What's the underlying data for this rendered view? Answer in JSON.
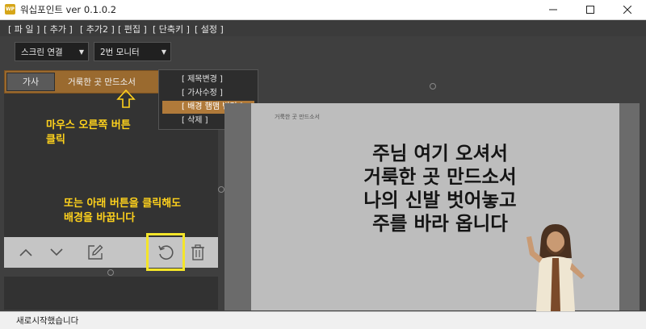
{
  "window": {
    "app_icon_text": "WP",
    "title": "워십포인트 ver 0.1.0.2"
  },
  "menu": {
    "items": [
      "[ 파 일 ]",
      "[ 추가 ]",
      "[ 추가2 ]",
      "[ 편집 ]",
      "[ 단축키 ]",
      "[ 설정 ]"
    ]
  },
  "controls": {
    "screen_select": "스크린 연결",
    "monitor_select": "2번 모니터"
  },
  "lyric_item": {
    "type_label": "가사",
    "title": "거룩한 곳 만드소서"
  },
  "context_menu": {
    "items": [
      "[ 제목변경 ]",
      "[ 가사수정 ]",
      "[ 배경 햄맴 변경 ]",
      "[ 삭제 ]"
    ],
    "active_index": 2
  },
  "annotations": {
    "right_click_line1": "마우스 오른쪽 버튼",
    "right_click_line2": "클릭",
    "button_line1": "또는 아래 버튼을 클릭해도",
    "button_line2": "배경을 바꿉니다"
  },
  "slide": {
    "small_title": "거룩한 곳 만드소서",
    "lines": [
      "주님 여기 오셔서",
      "거룩한 곳 만드소서",
      "나의 신발 벗어놓고",
      "주를 바라 옵니다"
    ]
  },
  "status": {
    "text": "새로시작했습니다"
  },
  "icons": {
    "up": "chevron-up-icon",
    "down": "chevron-down-icon",
    "edit": "edit-icon",
    "refresh": "refresh-icon",
    "delete": "trash-icon"
  },
  "colors": {
    "accent": "#9a6a2f",
    "highlight": "#f4e52a",
    "annotation": "#ffd21c"
  }
}
